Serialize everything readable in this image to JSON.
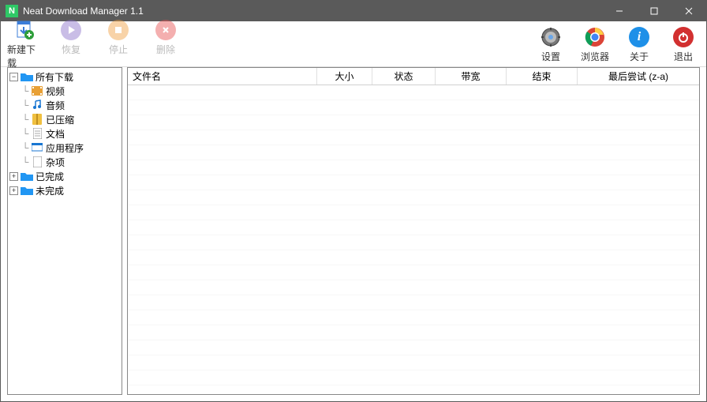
{
  "titlebar": {
    "icon_letter": "N",
    "title": "Neat Download Manager 1.1"
  },
  "toolbar": {
    "left": [
      {
        "id": "new-download",
        "label": "新建下载",
        "disabled": false
      },
      {
        "id": "resume",
        "label": "恢复",
        "disabled": true
      },
      {
        "id": "stop",
        "label": "停止",
        "disabled": true
      },
      {
        "id": "delete",
        "label": "删除",
        "disabled": true
      }
    ],
    "right": [
      {
        "id": "settings",
        "label": "设置"
      },
      {
        "id": "browser",
        "label": "浏览器"
      },
      {
        "id": "about",
        "label": "关于"
      },
      {
        "id": "exit",
        "label": "退出"
      }
    ]
  },
  "tree": {
    "all_downloads": {
      "label": "所有下载",
      "toggle": "−"
    },
    "children": [
      {
        "id": "video",
        "label": "视频"
      },
      {
        "id": "audio",
        "label": "音频"
      },
      {
        "id": "compressed",
        "label": "已压缩"
      },
      {
        "id": "document",
        "label": "文档"
      },
      {
        "id": "application",
        "label": "应用程序"
      },
      {
        "id": "misc",
        "label": "杂项"
      }
    ],
    "completed": {
      "label": "已完成",
      "toggle": "+"
    },
    "incomplete": {
      "label": "未完成",
      "toggle": "+"
    }
  },
  "columns": {
    "filename": "文件名",
    "size": "大小",
    "status": "状态",
    "bandwidth": "带宽",
    "end": "结束",
    "last_attempt": "最后尝试 (z-a)"
  },
  "rows": []
}
